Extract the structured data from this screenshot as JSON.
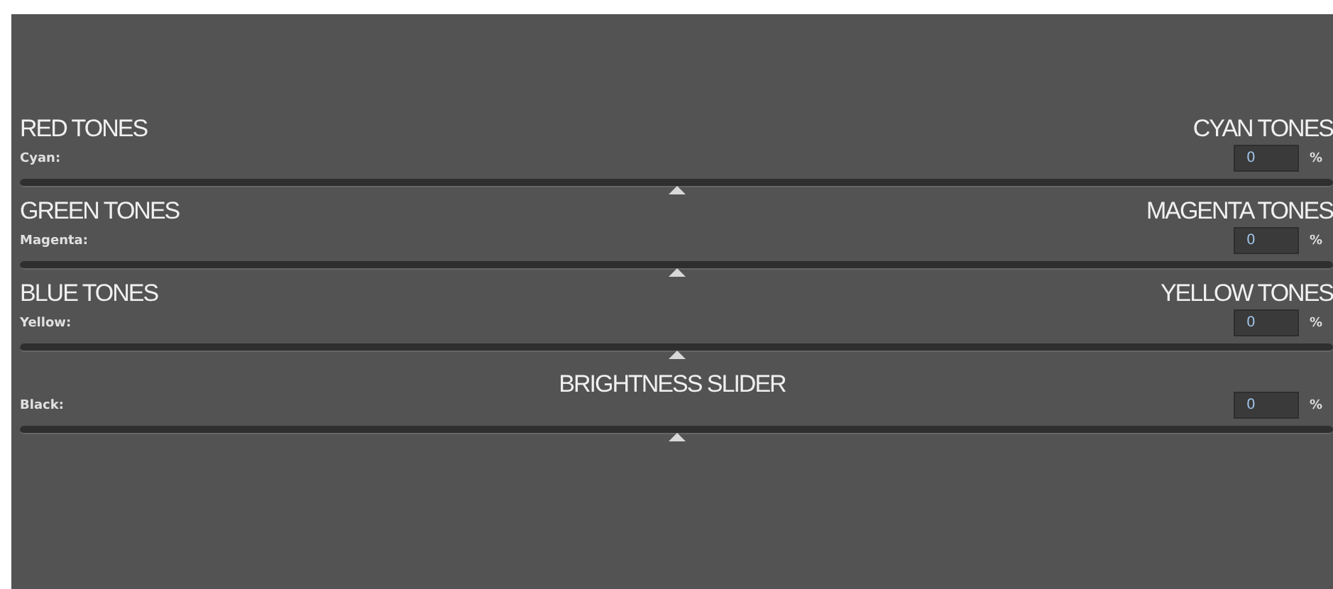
{
  "rows": [
    {
      "kind": "tones",
      "left_title": "RED TONES",
      "right_title": "CYAN TONES",
      "label": "Cyan:",
      "value": "0",
      "unit": "%",
      "level": 0.5
    },
    {
      "kind": "tones",
      "left_title": "GREEN TONES",
      "right_title": "MAGENTA TONES",
      "label": "Magenta:",
      "value": "0",
      "unit": "%",
      "level": 0.5
    },
    {
      "kind": "tones",
      "left_title": "BLUE TONES",
      "right_title": "YELLOW TONES",
      "label": "Yellow:",
      "value": "0",
      "unit": "%",
      "level": 0.5
    },
    {
      "kind": "brightness",
      "center_title": "BRIGHTNESS SLIDER",
      "label": "Black:",
      "value": "0",
      "unit": "%",
      "level": 0.5
    }
  ]
}
